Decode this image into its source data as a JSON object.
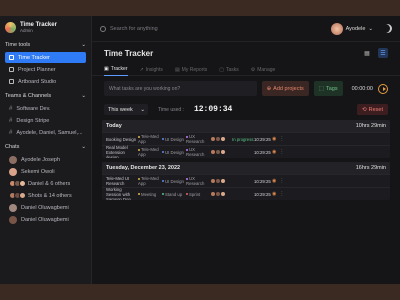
{
  "app": {
    "name": "Time Tracker",
    "role": "Admin"
  },
  "sidebar": {
    "time_tools_label": "Time tools",
    "time_tools": [
      {
        "label": "Time Tracker",
        "active": true
      },
      {
        "label": "Project Planner"
      },
      {
        "label": "Artboard Studio"
      }
    ],
    "teams_label": "Teams & Channels",
    "teams": [
      {
        "label": "Software Dev."
      },
      {
        "label": "Design Stripe"
      },
      {
        "label": "Ayodele, Daniel, Samuel,..."
      }
    ],
    "chats_label": "Chats",
    "chats": [
      {
        "label": "Ayodele Joseph"
      },
      {
        "label": "Sekemi Owoli"
      },
      {
        "label": "Daniel & 6 others"
      },
      {
        "label": "Shots & 14 others"
      },
      {
        "label": "Daniel Oluwagbemi"
      },
      {
        "label": "Daniel Oluwagbemi"
      }
    ]
  },
  "topbar": {
    "search_placeholder": "Search for anything",
    "user_name": "Ayodele"
  },
  "page": {
    "title": "Time Tracker"
  },
  "tabs": [
    {
      "label": "Tracker",
      "active": true
    },
    {
      "label": "Insights"
    },
    {
      "label": "My Reports"
    },
    {
      "label": "Tasks"
    },
    {
      "label": "Manage"
    }
  ],
  "task": {
    "placeholder": "What tasks are you working on?",
    "add_projects": "Add projects",
    "tags": "Tags",
    "timer": "00:00:00"
  },
  "timer": {
    "week": "This week",
    "time_used_label": "Time used :",
    "time_used": "12:09:34",
    "reset_label": "Reset"
  },
  "groups": [
    {
      "date": "Today",
      "total": "10hrs 29min",
      "entries": [
        {
          "name": "Booking Design",
          "team": "Tele-Med App",
          "design": "UI Design",
          "research": "UX Research",
          "status": "In progress",
          "time": "10:29:25"
        },
        {
          "name": "Real Model Extension design",
          "team": "Tele-Med App",
          "design": "UI Design",
          "research": "UX Research",
          "status": "",
          "time": "10:29:25"
        }
      ]
    },
    {
      "date": "Tuesday, December 23, 2022",
      "total": "16hrs 29min",
      "entries": [
        {
          "name": "Tele-Med UI Research",
          "team": "Tele-Med App",
          "design": "UI Design",
          "research": "UX Research",
          "status": "",
          "time": "10:29:25"
        },
        {
          "name": "Working Session with Samson Don",
          "team": "Meeting",
          "design": "Stand up",
          "research": "Sprint",
          "status": "",
          "time": "10:29:25"
        }
      ]
    }
  ]
}
